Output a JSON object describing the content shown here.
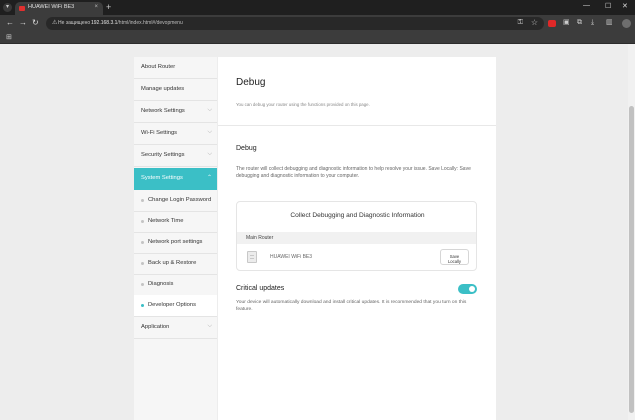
{
  "browser": {
    "tab_title": "HUAWEI WiFi BE3",
    "tab_close": "×",
    "new_tab": "+",
    "back": "←",
    "forward": "→",
    "reload": "↻",
    "security_icon": "warning-triangle-icon",
    "security_label": "Не защищено",
    "url_host": "192.168.3.1",
    "url_path": "/html/index.html#/devopmenu",
    "window_controls": {
      "minimize": "—",
      "maximize": "☐",
      "close": "✕"
    }
  },
  "sidebar": {
    "items": [
      {
        "label": "About Router",
        "has_chevron": false
      },
      {
        "label": "Manage updates",
        "has_chevron": false
      },
      {
        "label": "Network Settings",
        "has_chevron": true
      },
      {
        "label": "Wi-Fi Settings",
        "has_chevron": true
      },
      {
        "label": "Security Settings",
        "has_chevron": true
      },
      {
        "label": "System Settings",
        "has_chevron": true,
        "active": true
      }
    ],
    "subitems": [
      {
        "label": "Change Login Password"
      },
      {
        "label": "Network Time"
      },
      {
        "label": "Network port settings"
      },
      {
        "label": "Back up & Restore"
      },
      {
        "label": "Diagnosis"
      },
      {
        "label": "Developer Options",
        "current": true
      }
    ],
    "application": {
      "label": "Application",
      "has_chevron": true
    }
  },
  "main": {
    "title": "Debug",
    "description": "You can debug your router using the functions provided on this page.",
    "debug_section": {
      "title": "Debug",
      "text": "The router will collect debugging and diagnostic information to help resolve your issue. Save Locally: Save debugging and diagnostic information to your computer."
    },
    "card": {
      "title": "Collect Debugging and Diagnostic Information",
      "header": "Main Router",
      "device_name": "HUAWEI WiFi BE3",
      "save_button_line1": "Save",
      "save_button_line2": "Locally"
    },
    "critical_updates": {
      "title": "Critical updates",
      "enabled": true,
      "text": "Your device will automatically download and install critical updates. It is recommended that you turn on this feature."
    }
  },
  "colors": {
    "accent": "#3bbfc6",
    "brand_red": "#e0302f"
  }
}
